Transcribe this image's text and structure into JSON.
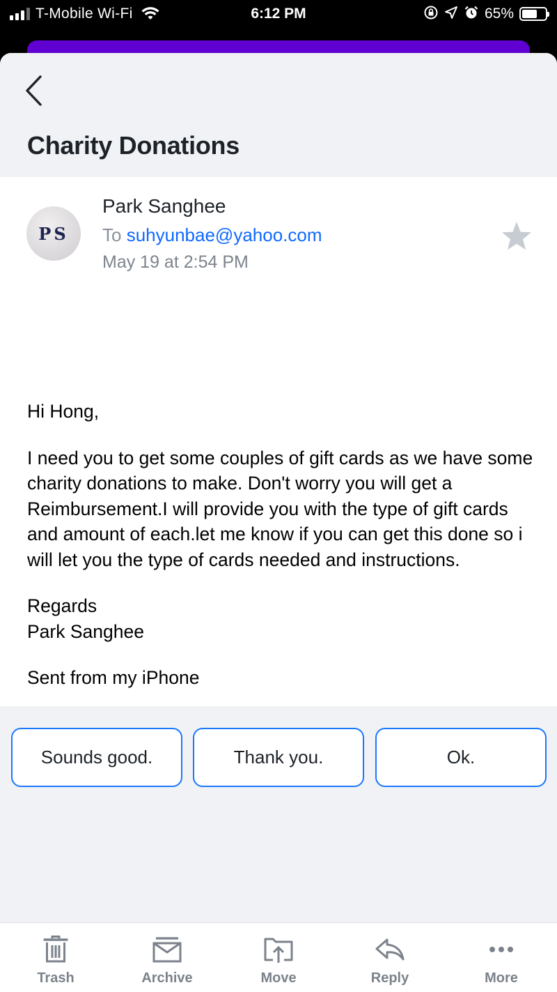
{
  "status_bar": {
    "carrier": "T-Mobile Wi-Fi",
    "time": "6:12 PM",
    "battery_percent": "65%",
    "battery_level": 0.65
  },
  "header": {
    "subject": "Charity Donations"
  },
  "message": {
    "avatar_initials": "PS",
    "sender": "Park Sanghee",
    "to_prefix": "To",
    "to_address": "suhyunbae@yahoo.com",
    "date": "May 19 at 2:54 PM",
    "body": {
      "greeting": "Hi Hong,",
      "paragraph": "I need you to get some couples of gift cards as we have some charity donations to make. Don't worry you will get a Reimbursement.I will provide you with the type of gift cards and amount of each.let me know if you can get this done so i will let you the type of cards needed and instructions.",
      "closing": "Regards",
      "signature": "Park Sanghee",
      "footer": "Sent from my iPhone"
    }
  },
  "quick_replies": [
    "Sounds good.",
    "Thank you.",
    "Ok."
  ],
  "toolbar": {
    "items": [
      {
        "label": "Trash",
        "icon": "trash-icon"
      },
      {
        "label": "Archive",
        "icon": "archive-icon"
      },
      {
        "label": "Move",
        "icon": "move-icon"
      },
      {
        "label": "Reply",
        "icon": "reply-icon"
      },
      {
        "label": "More",
        "icon": "more-icon"
      }
    ]
  },
  "colors": {
    "accent_blue": "#1b77ff",
    "link_blue": "#0f69ff",
    "brand_purple": "#6001d2",
    "toolbar_gray": "#7b828b"
  }
}
